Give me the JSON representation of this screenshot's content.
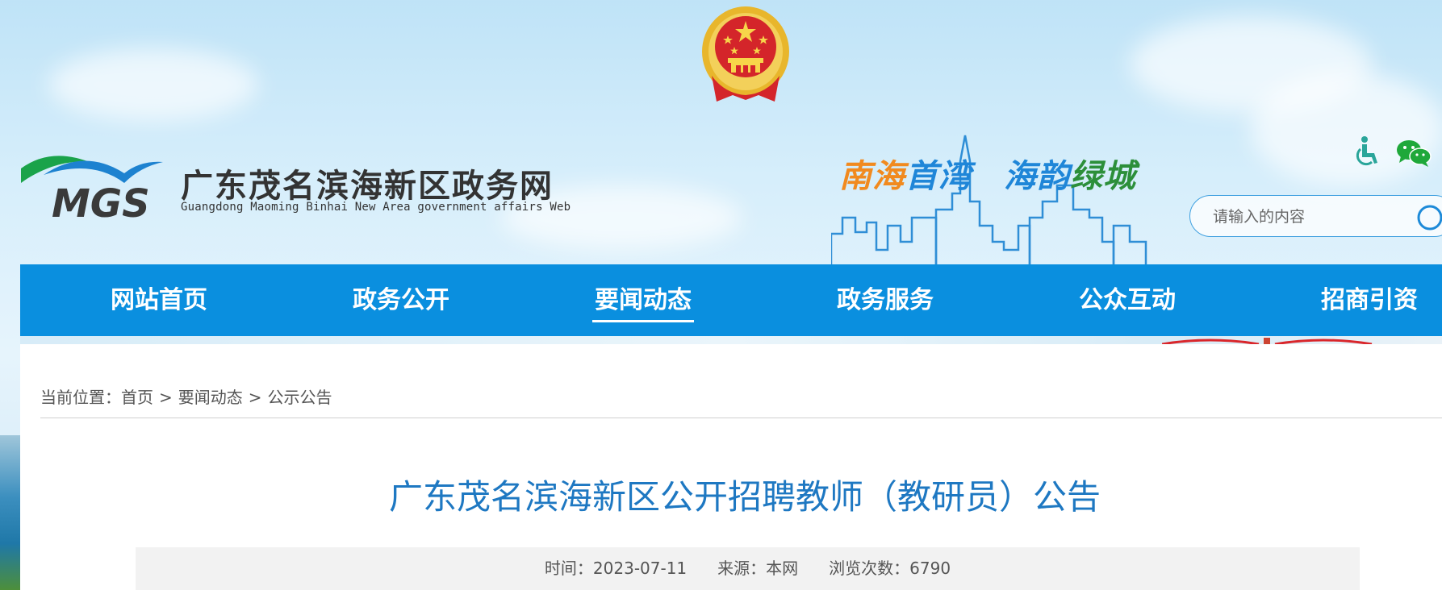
{
  "header": {
    "site_title": "广东茂名滨海新区政务网",
    "site_subtitle": "Guangdong Maoming Binhai New Area government affairs Web",
    "logo_text": "MGS",
    "slogan": [
      "南海",
      "首湾",
      "海韵",
      "绿城"
    ]
  },
  "search": {
    "placeholder": "请输入的内容"
  },
  "nav": {
    "items": [
      {
        "label": "网站首页",
        "active": false
      },
      {
        "label": "政务公开",
        "active": false
      },
      {
        "label": "要闻动态",
        "active": true
      },
      {
        "label": "政务服务",
        "active": false
      },
      {
        "label": "公众互动",
        "active": false
      },
      {
        "label": "招商引资",
        "active": false
      }
    ]
  },
  "breadcrumb": {
    "prefix": "当前位置：",
    "items": [
      "首页",
      "要闻动态",
      "公示公告"
    ],
    "separator": ">"
  },
  "article": {
    "title": "广东茂名滨海新区公开招聘教师（教研员）公告",
    "time": "时间：2023-07-11",
    "source": "来源：本网",
    "views": "浏览次数：6790"
  },
  "colors": {
    "nav_bg": "#0a8fdf",
    "title_color": "#1e78c2",
    "slogan_orange": "#f18a1f",
    "slogan_blue": "#1f86d8",
    "slogan_green": "#2c8f3a"
  },
  "icons": [
    "national-emblem-icon",
    "accessibility-icon",
    "wechat-icon",
    "search-icon"
  ]
}
